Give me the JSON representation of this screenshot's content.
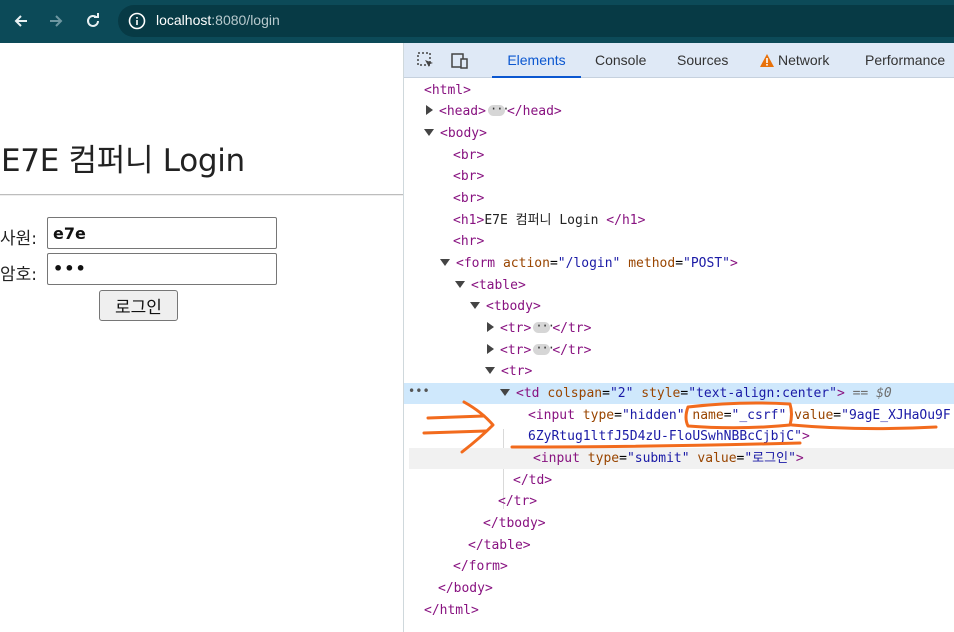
{
  "browser": {
    "url_host": "localhost",
    "url_path": ":8080/login"
  },
  "page": {
    "heading": "E7E 컴퍼니 Login",
    "employee_label": "사원:",
    "employee_value": "e7e",
    "password_label": "암호:",
    "password_value": "•••",
    "login_button": "로그인"
  },
  "devtools": {
    "tabs": [
      "Elements",
      "Console",
      "Sources",
      "Network",
      "Performance"
    ],
    "active_tab": "Elements",
    "selected_suffix": "== $0",
    "tree": {
      "html_open": "<html>",
      "head": "<head>",
      "head_close": "</head>",
      "body_open": "<body>",
      "br": "<br>",
      "h1_open": "<h1>",
      "h1_text": "E7E 컴퍼니 Login ",
      "h1_close": "</h1>",
      "hr": "<hr>",
      "form_tag": "<form",
      "form_action_attr": "action",
      "form_action_val": "\"/login\"",
      "form_method_attr": "method",
      "form_method_val": "\"POST\"",
      "table_open": "<table>",
      "tbody_open": "<tbody>",
      "tr_open": "<tr>",
      "tr_close": "</tr>",
      "td_tag": "<td",
      "td_colspan_attr": "colspan",
      "td_colspan_val": "\"2\"",
      "td_style_attr": "style",
      "td_style_val": "\"text-align:center\"",
      "input_tag": "<input",
      "type_attr": "type",
      "hidden_val": "\"hidden\"",
      "name_attr": "name",
      "name_val": "\"_csrf\"",
      "value_attr": "value",
      "csrf_val_start": "\"9agE_XJHaOu9F",
      "csrf_val_end": "6ZyRtug1ltfJ5D4zU-FloUSwhNBBcCjbjC\"",
      "submit_val": "\"submit\"",
      "submit_value_val": "\"로그인\"",
      "td_close": "</td>",
      "tbody_close": "</tbody>",
      "table_close": "</table>",
      "form_close": "</form>",
      "body_close": "</body>",
      "html_close": "</html>",
      "gt": ">",
      "ellipsis": "•••"
    }
  },
  "colors": {
    "toolbar": "#0c4a58",
    "annotation": "#f26b1d",
    "tag": "#881280",
    "attr": "#994500",
    "value": "#1a1aa6"
  }
}
